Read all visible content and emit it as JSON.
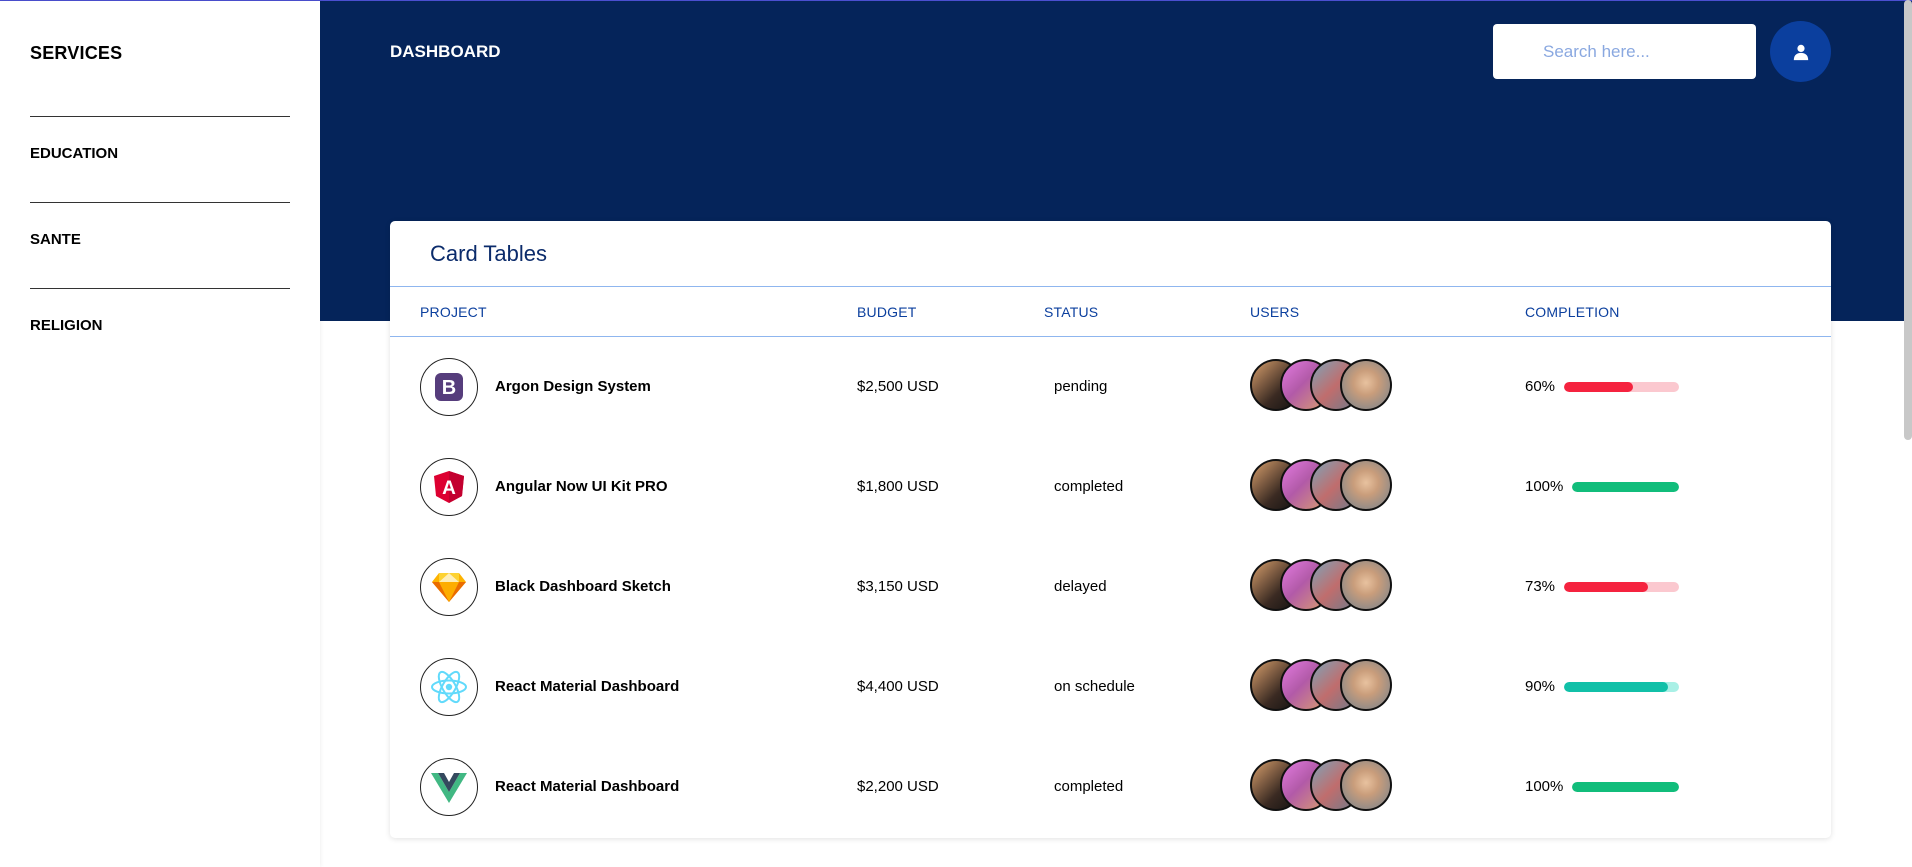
{
  "sidebar": {
    "brand": "SERVICES",
    "items": [
      {
        "label": "EDUCATION"
      },
      {
        "label": "SANTE"
      },
      {
        "label": "RELIGION"
      }
    ]
  },
  "header": {
    "title": "DASHBOARD",
    "search_placeholder": "Search here...",
    "user_icon": "user-icon"
  },
  "card": {
    "title": "Card Tables",
    "columns": {
      "project": "PROJECT",
      "budget": "BUDGET",
      "status": "STATUS",
      "users": "USERS",
      "completion": "COMPLETION"
    },
    "rows": [
      {
        "logo_icon": "bootstrap-logo-icon",
        "name": "Argon Design System",
        "budget": "$2,500 USD",
        "status": "pending",
        "completion_label": "60%",
        "completion": 60,
        "bar_color": "#f5233f",
        "track_color": "#fbc8cf"
      },
      {
        "logo_icon": "angular-logo-icon",
        "name": "Angular Now UI Kit PRO",
        "budget": "$1,800 USD",
        "status": "completed",
        "completion_label": "100%",
        "completion": 100,
        "bar_color": "#11bd7b",
        "track_color": "#b7ecd8"
      },
      {
        "logo_icon": "sketch-logo-icon",
        "name": "Black Dashboard Sketch",
        "budget": "$3,150 USD",
        "status": "delayed",
        "completion_label": "73%",
        "completion": 73,
        "bar_color": "#f5233f",
        "track_color": "#fbc8cf"
      },
      {
        "logo_icon": "react-logo-icon",
        "name": "React Material Dashboard",
        "budget": "$4,400 USD",
        "status": "on schedule",
        "completion_label": "90%",
        "completion": 90,
        "bar_color": "#11c0a8",
        "track_color": "#a9f0e6"
      },
      {
        "logo_icon": "vue-logo-icon",
        "name": "React Material Dashboard",
        "budget": "$2,200 USD",
        "status": "completed",
        "completion_label": "100%",
        "completion": 100,
        "bar_color": "#11bd7b",
        "track_color": "#b7ecd8"
      }
    ]
  },
  "colors": {
    "header_bg": "#05245a",
    "accent_text": "#0b3f9e"
  }
}
